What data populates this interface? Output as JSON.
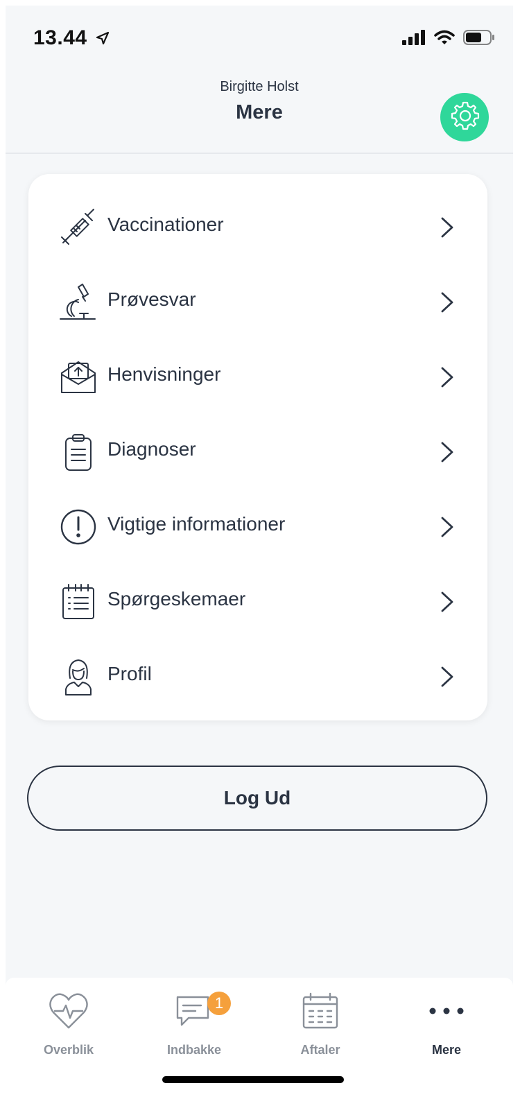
{
  "status_bar": {
    "time": "13.44"
  },
  "header": {
    "subtitle": "Birgitte Holst",
    "title": "Mere"
  },
  "menu": {
    "items": [
      {
        "label": "Vaccinationer",
        "icon": "syringe-icon"
      },
      {
        "label": "Prøvesvar",
        "icon": "microscope-icon"
      },
      {
        "label": "Henvisninger",
        "icon": "envelope-upload-icon"
      },
      {
        "label": "Diagnoser",
        "icon": "clipboard-icon"
      },
      {
        "label": "Vigtige informationer",
        "icon": "exclamation-circle-icon"
      },
      {
        "label": "Spørgeskemaer",
        "icon": "checklist-calendar-icon"
      },
      {
        "label": "Profil",
        "icon": "person-icon"
      }
    ]
  },
  "logout": {
    "label": "Log Ud"
  },
  "tabbar": {
    "tabs": [
      {
        "label": "Overblik",
        "icon": "heart-pulse-icon"
      },
      {
        "label": "Indbakke",
        "icon": "message-icon",
        "badge": "1"
      },
      {
        "label": "Aftaler",
        "icon": "calendar-icon"
      },
      {
        "label": "Mere",
        "icon": "more-dots-icon",
        "active": true
      }
    ]
  },
  "colors": {
    "accent": "#2fd79a",
    "text": "#2b3443",
    "badge": "#f5a03c",
    "inactive": "#8a9099"
  }
}
